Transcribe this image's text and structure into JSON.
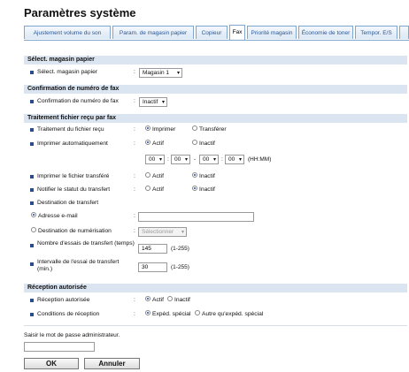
{
  "page_title": "Paramètres système",
  "tabs": [
    {
      "label": "Ajustement volume du son"
    },
    {
      "label": "Param. de magasin papier"
    },
    {
      "label": "Copieur"
    },
    {
      "label": "Fax"
    },
    {
      "label": "Priorité magasin"
    },
    {
      "label": "Économie de toner"
    },
    {
      "label": "Tempor. E/S"
    }
  ],
  "sections": {
    "paper_tray": "Sélect. magasin papier",
    "fax_confirm": "Confirmation de numéro de fax",
    "received_file": "Traitement fichier reçu par fax",
    "authorized": "Réception autorisée"
  },
  "rows": {
    "paper_tray_label": "Sélect. magasin papier",
    "paper_tray_value": "Magasin 1",
    "fax_confirm_label": "Confirmation de numéro de fax",
    "fax_confirm_value": "Inactif",
    "processing_label": "Traitement du fichier reçu",
    "processing_opt1": "Imprimer",
    "processing_opt2": "Transférer",
    "autoprint_label": "Imprimer automatiquement",
    "autoprint_opt1": "Actif",
    "autoprint_opt2": "Inactif",
    "time_h1": "00",
    "time_m1": "00",
    "time_h2": "00",
    "time_m2": "00",
    "time_dash": "-",
    "time_colon": ":",
    "time_format": "(HH:MM)",
    "print_transferred_label": "Imprimer le fichier transféré",
    "print_transferred_opt1": "Actif",
    "print_transferred_opt2": "Inactif",
    "notify_label": "Notifier le statut du transfert",
    "notify_opt1": "Actif",
    "notify_opt2": "Inactif",
    "destination_label": "Destination de transfert",
    "email_label": "Adresse e-mail",
    "email_value": "",
    "scan_dest_label": "Destination de numérisation",
    "scan_dest_value": "Sélectionner",
    "retries_label": "Nombre d'essais de transfert (temps)",
    "retries_value": "145",
    "retries_range": "(1-255)",
    "interval_label": "Intervalle de l'essai de transfert (min.)",
    "interval_value": "30",
    "interval_range": "(1-255)",
    "authorized_label": "Réception autorisée",
    "authorized_opt1": "Actif",
    "authorized_opt2": "Inactif",
    "conditions_label": "Conditions de réception",
    "conditions_opt1": "Expéd. spécial",
    "conditions_opt2": "Autre qu'expéd. spécial"
  },
  "colon": ":",
  "password": {
    "label": "Saisir le mot de passe administrateur.",
    "value": ""
  },
  "buttons": {
    "ok": "OK",
    "cancel": "Annuler"
  },
  "colors": {
    "section_bg": "#dbe5f1",
    "tab_border": "#7fa6cf",
    "tab_text": "#2b5797",
    "bullet": "#2b4c8c"
  }
}
